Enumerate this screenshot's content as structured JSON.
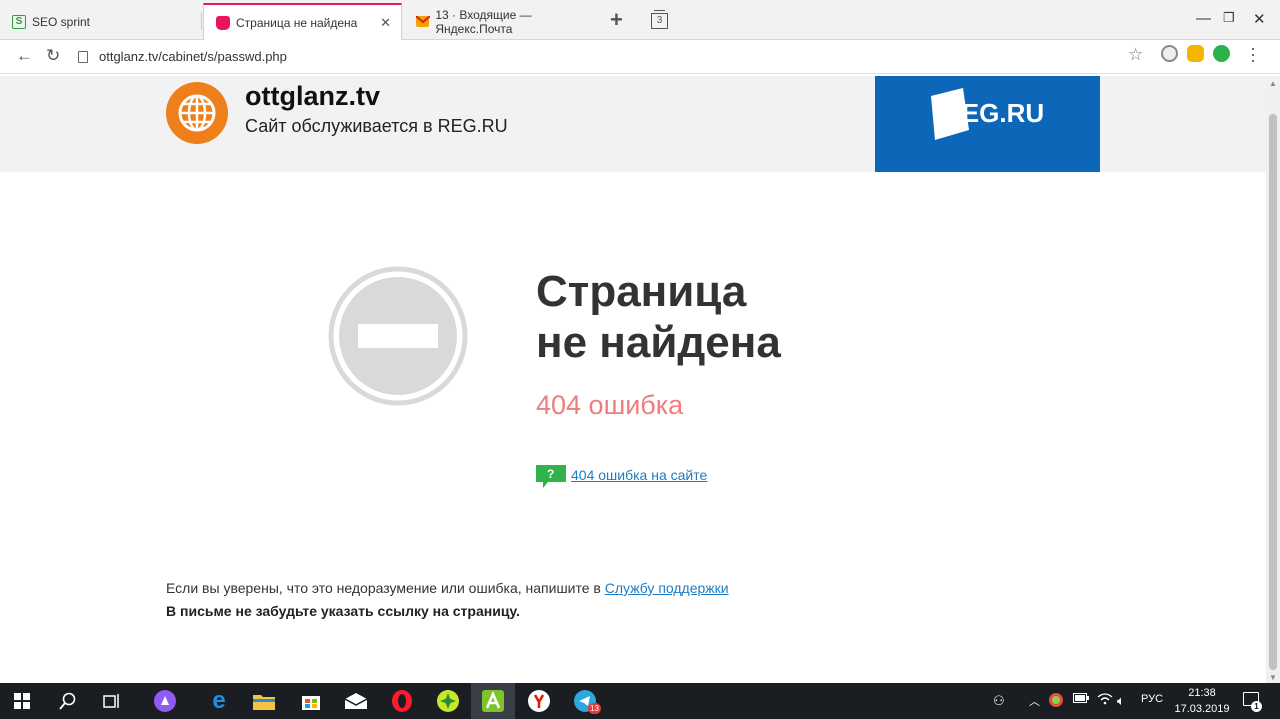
{
  "browser": {
    "tabs": [
      {
        "label": "SEO sprint",
        "favicon": "seosprint-icon",
        "color": "#2e9b3a",
        "active": false
      },
      {
        "label": "Страница не найдена",
        "favicon": "regru-page-icon",
        "color": "#e8175d",
        "active": true
      },
      {
        "label": "13 · Входящие — Яндекс.Почта",
        "favicon": "yandex-mail-icon",
        "color": "#f5a200",
        "active": false
      }
    ],
    "tab_count": "3",
    "url": "ottglanz.tv/cabinet/s/passwd.php",
    "extensions": [
      "adguard-icon",
      "chat-extension-icon",
      "notes-extension-icon"
    ]
  },
  "header": {
    "site_name": "ottglanz.tv",
    "subtitle": "Сайт обслуживается в REG.RU",
    "brand": "REG.RU",
    "brand_color": "#0d67b8",
    "globe_color": "#ee7f1a"
  },
  "error": {
    "title_line1": "Страница",
    "title_line2": "не найдена",
    "code_text": "404 ошибка",
    "code_color": "#ef7d7d",
    "help_link": "404 ошибка на сайте",
    "help_icon_color": "#2fb34a"
  },
  "footer": {
    "note_prefix": "Если вы уверены, что это недоразумение или ошибка, напишите в ",
    "support_link": "Службу поддержки",
    "note_bold": "В письме не забудьте указать ссылку на страницу."
  },
  "taskbar": {
    "apps": [
      "windows-start-icon",
      "search-icon",
      "task-view-icon",
      "alice-icon",
      "edge-icon",
      "file-explorer-icon",
      "store-icon",
      "mail-icon",
      "opera-icon",
      "game-icon",
      "android-icon",
      "yandex-browser-icon",
      "telegram-icon"
    ],
    "telegram_badge": "13",
    "language": "РУС",
    "time": "21:38",
    "date": "17.03.2019",
    "notifications": "1"
  }
}
